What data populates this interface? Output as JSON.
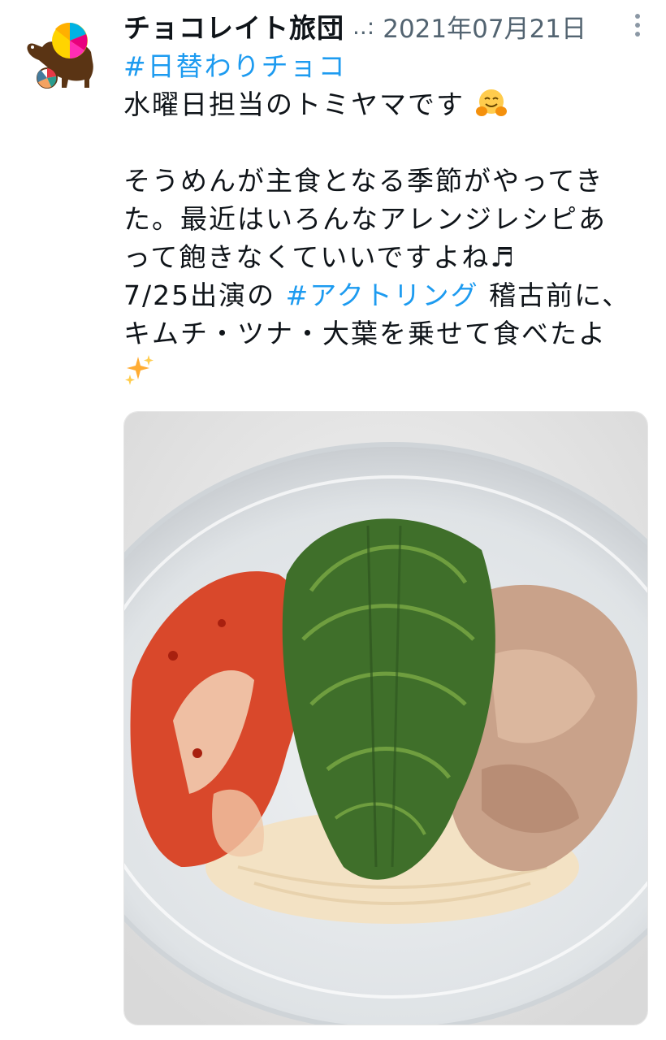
{
  "tweet": {
    "display_name": "チョコレイト旅団",
    "handle": "..:",
    "date": "2021年07月21日",
    "avatar_icon": "carousel-horse-logo-icon",
    "more_icon": "vertical-dots-icon",
    "lines": {
      "l1_hashtag": "#日替わりチョコ",
      "l2_text": "水曜日担当のトミヤマです",
      "l2_emoji": "hugging-face-emoji",
      "l4_text": "そうめんが主食となる季節がやってき",
      "l5_text": "た。最近はいろんなアレンジレシピあ",
      "l6_text": "って飽きなくていいですよね♬",
      "l7_prefix": "7/25出演の ",
      "l7_hashtag": "#アクトリング",
      "l7_suffix": " 稽古前に、",
      "l8_text": "キムチ・ツナ・大葉を乗せて食べたよ",
      "l9_emoji": "sparkles-emoji"
    },
    "photo": {
      "subject": "photo-somen-kimchi-tuna-shiso-bowl"
    }
  },
  "colors": {
    "text": "#0f1419",
    "secondary": "#536471",
    "link": "#1d9bf0"
  }
}
